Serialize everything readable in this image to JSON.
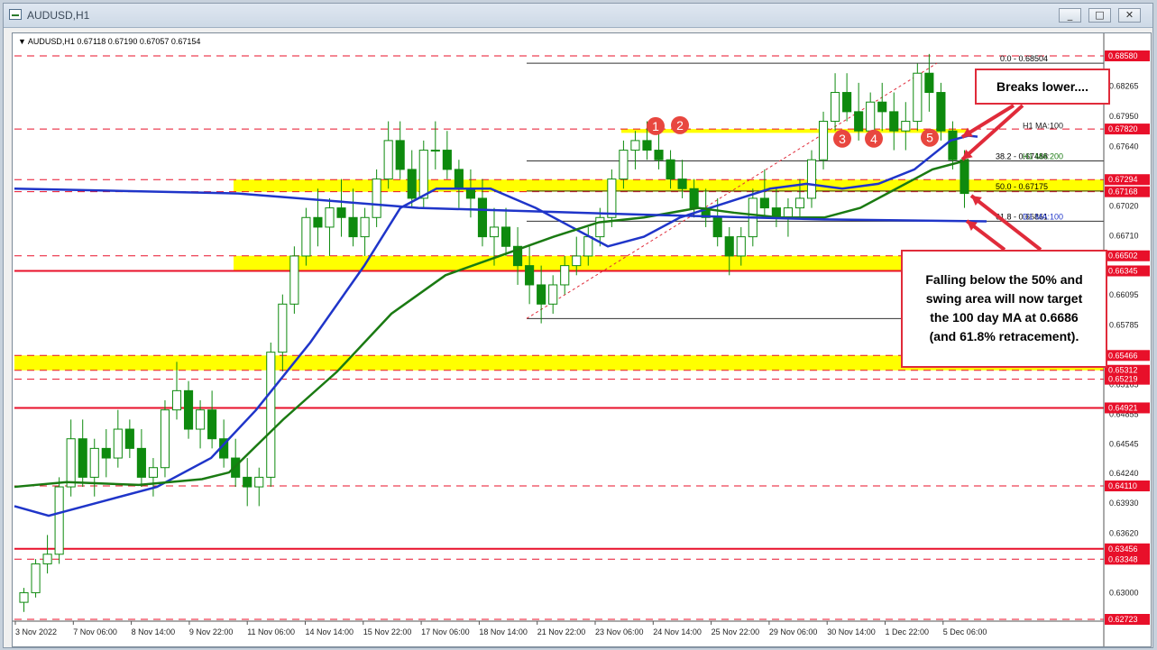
{
  "window": {
    "title": "AUDUSD,H1"
  },
  "window_buttons": {
    "minimize": "_",
    "maximize": "□",
    "close": "✕"
  },
  "chart_data": {
    "type": "candlestick",
    "symbol_info": "AUDUSD,H1  0.67118 0.67190 0.67057 0.67154",
    "ylim": [
      0.62723,
      0.6858
    ],
    "x_labels": [
      "3 Nov 2022",
      "7 Nov 06:00",
      "8 Nov 14:00",
      "9 Nov 22:00",
      "11 Nov 06:00",
      "14 Nov 14:00",
      "15 Nov 22:00",
      "17 Nov 06:00",
      "18 Nov 14:00",
      "21 Nov 22:00",
      "23 Nov 06:00",
      "24 Nov 14:00",
      "25 Nov 22:00",
      "29 Nov 06:00",
      "30 Nov 14:00",
      "1 Dec 22:00",
      "5 Dec 06:00"
    ],
    "y_ticks": [
      "0.68265",
      "0.67950",
      "0.67640",
      "0.67020",
      "0.66710",
      "0.66095",
      "0.65785",
      "0.65165",
      "0.64855",
      "0.64545",
      "0.64240",
      "0.63930",
      "0.63620",
      "0.63000"
    ],
    "price_labels": [
      {
        "text": "0.68580",
        "value": 0.6858,
        "color": "#e8102a"
      },
      {
        "text": "0.67820",
        "value": 0.6782,
        "color": "#e8102a"
      },
      {
        "text": "0.67294",
        "value": 0.67294,
        "color": "#e8102a"
      },
      {
        "text": "0.67168",
        "value": 0.67168,
        "color": "#e8102a"
      },
      {
        "text": "0.66502",
        "value": 0.66502,
        "color": "#e8102a"
      },
      {
        "text": "0.66345",
        "value": 0.66345,
        "color": "#e8102a"
      },
      {
        "text": "0.65466",
        "value": 0.65466,
        "color": "#e8102a"
      },
      {
        "text": "0.65312",
        "value": 0.65312,
        "color": "#e8102a"
      },
      {
        "text": "0.65219",
        "value": 0.65219,
        "color": "#e8102a"
      },
      {
        "text": "0.64921",
        "value": 0.64921,
        "color": "#e8102a"
      },
      {
        "text": "0.64110",
        "value": 0.6411,
        "color": "#e8102a"
      },
      {
        "text": "0.63456",
        "value": 0.63456,
        "color": "#e8102a"
      },
      {
        "text": "0.63348",
        "value": 0.63348,
        "color": "#e8102a"
      },
      {
        "text": "0.62723",
        "value": 0.62723,
        "color": "#e8102a"
      }
    ],
    "horizontal_levels": [
      {
        "value": 0.6858,
        "style": "dashed"
      },
      {
        "value": 0.6782,
        "style": "dashed"
      },
      {
        "value": 0.67294,
        "style": "dashed"
      },
      {
        "value": 0.67168,
        "style": "dashed"
      },
      {
        "value": 0.66502,
        "style": "dashed"
      },
      {
        "value": 0.66345,
        "style": "solid"
      },
      {
        "value": 0.65466,
        "style": "dashed"
      },
      {
        "value": 0.65312,
        "style": "dashed"
      },
      {
        "value": 0.65219,
        "style": "dashed"
      },
      {
        "value": 0.64921,
        "style": "solid"
      },
      {
        "value": 0.6411,
        "style": "dashed"
      },
      {
        "value": 0.63456,
        "style": "solid"
      },
      {
        "value": 0.63348,
        "style": "dashed"
      },
      {
        "value": 0.62723,
        "style": "dashed"
      }
    ],
    "swing_zones": [
      [
        0.67168,
        0.67294
      ],
      [
        0.66345,
        0.66502
      ],
      [
        0.65312,
        0.65466
      ],
      [
        0.6778,
        0.6782
      ]
    ],
    "fibonacci": [
      {
        "label": "0.0 - 0.68504",
        "value": 0.68504
      },
      {
        "label": "38.2 - 0.67488",
        "value": 0.67488
      },
      {
        "label": "50.0 - 0.67175",
        "value": 0.67175
      },
      {
        "label": "61.8 - 0.66861",
        "value": 0.66861
      }
    ],
    "fib_low": 0.6585,
    "ma_labels": [
      {
        "text": "H1 MA:100",
        "value": 0.67749
      },
      {
        "text": "H1 MA:200",
        "value": 0.67488
      },
      {
        "text": "D1 MA:100",
        "value": 0.66861
      }
    ],
    "candles": [
      [
        0.629,
        0.6305,
        0.628,
        0.63
      ],
      [
        0.63,
        0.6335,
        0.6295,
        0.633
      ],
      [
        0.633,
        0.636,
        0.632,
        0.634
      ],
      [
        0.634,
        0.642,
        0.633,
        0.641
      ],
      [
        0.641,
        0.648,
        0.64,
        0.646
      ],
      [
        0.646,
        0.648,
        0.641,
        0.642
      ],
      [
        0.642,
        0.646,
        0.64,
        0.645
      ],
      [
        0.645,
        0.647,
        0.642,
        0.644
      ],
      [
        0.644,
        0.649,
        0.643,
        0.647
      ],
      [
        0.647,
        0.648,
        0.644,
        0.645
      ],
      [
        0.645,
        0.647,
        0.641,
        0.642
      ],
      [
        0.642,
        0.644,
        0.64,
        0.643
      ],
      [
        0.643,
        0.65,
        0.642,
        0.649
      ],
      [
        0.649,
        0.654,
        0.648,
        0.651
      ],
      [
        0.651,
        0.652,
        0.646,
        0.647
      ],
      [
        0.647,
        0.65,
        0.645,
        0.649
      ],
      [
        0.649,
        0.651,
        0.645,
        0.646
      ],
      [
        0.646,
        0.648,
        0.643,
        0.644
      ],
      [
        0.644,
        0.646,
        0.641,
        0.642
      ],
      [
        0.642,
        0.644,
        0.639,
        0.641
      ],
      [
        0.641,
        0.643,
        0.639,
        0.642
      ],
      [
        0.642,
        0.656,
        0.641,
        0.655
      ],
      [
        0.655,
        0.661,
        0.653,
        0.66
      ],
      [
        0.66,
        0.666,
        0.659,
        0.665
      ],
      [
        0.665,
        0.67,
        0.664,
        0.669
      ],
      [
        0.669,
        0.672,
        0.666,
        0.668
      ],
      [
        0.668,
        0.671,
        0.665,
        0.67
      ],
      [
        0.67,
        0.673,
        0.667,
        0.669
      ],
      [
        0.669,
        0.672,
        0.666,
        0.667
      ],
      [
        0.667,
        0.67,
        0.665,
        0.669
      ],
      [
        0.669,
        0.674,
        0.668,
        0.673
      ],
      [
        0.673,
        0.679,
        0.672,
        0.677
      ],
      [
        0.677,
        0.679,
        0.673,
        0.674
      ],
      [
        0.674,
        0.676,
        0.67,
        0.671
      ],
      [
        0.671,
        0.677,
        0.67,
        0.676
      ],
      [
        0.676,
        0.679,
        0.674,
        0.676
      ],
      [
        0.676,
        0.678,
        0.673,
        0.674
      ],
      [
        0.674,
        0.675,
        0.67,
        0.672
      ],
      [
        0.672,
        0.674,
        0.669,
        0.671
      ],
      [
        0.671,
        0.673,
        0.666,
        0.667
      ],
      [
        0.667,
        0.67,
        0.664,
        0.668
      ],
      [
        0.668,
        0.67,
        0.665,
        0.666
      ],
      [
        0.666,
        0.668,
        0.662,
        0.664
      ],
      [
        0.664,
        0.666,
        0.66,
        0.662
      ],
      [
        0.662,
        0.664,
        0.658,
        0.66
      ],
      [
        0.66,
        0.663,
        0.659,
        0.662
      ],
      [
        0.662,
        0.665,
        0.661,
        0.664
      ],
      [
        0.664,
        0.667,
        0.663,
        0.665
      ],
      [
        0.665,
        0.668,
        0.664,
        0.667
      ],
      [
        0.667,
        0.67,
        0.666,
        0.669
      ],
      [
        0.669,
        0.674,
        0.668,
        0.673
      ],
      [
        0.673,
        0.677,
        0.672,
        0.676
      ],
      [
        0.676,
        0.678,
        0.674,
        0.677
      ],
      [
        0.677,
        0.679,
        0.675,
        0.676
      ],
      [
        0.676,
        0.679,
        0.674,
        0.675
      ],
      [
        0.675,
        0.676,
        0.672,
        0.673
      ],
      [
        0.673,
        0.675,
        0.671,
        0.672
      ],
      [
        0.672,
        0.673,
        0.669,
        0.67
      ],
      [
        0.67,
        0.672,
        0.668,
        0.669
      ],
      [
        0.669,
        0.671,
        0.666,
        0.667
      ],
      [
        0.667,
        0.668,
        0.663,
        0.665
      ],
      [
        0.665,
        0.668,
        0.664,
        0.667
      ],
      [
        0.667,
        0.672,
        0.666,
        0.671
      ],
      [
        0.671,
        0.674,
        0.669,
        0.67
      ],
      [
        0.67,
        0.672,
        0.668,
        0.669
      ],
      [
        0.669,
        0.671,
        0.667,
        0.67
      ],
      [
        0.67,
        0.673,
        0.669,
        0.671
      ],
      [
        0.671,
        0.676,
        0.67,
        0.675
      ],
      [
        0.675,
        0.68,
        0.674,
        0.679
      ],
      [
        0.679,
        0.684,
        0.678,
        0.682
      ],
      [
        0.682,
        0.684,
        0.679,
        0.68
      ],
      [
        0.68,
        0.683,
        0.677,
        0.678
      ],
      [
        0.678,
        0.682,
        0.677,
        0.681
      ],
      [
        0.681,
        0.683,
        0.678,
        0.68
      ],
      [
        0.68,
        0.682,
        0.676,
        0.678
      ],
      [
        0.678,
        0.681,
        0.676,
        0.679
      ],
      [
        0.679,
        0.685,
        0.678,
        0.684
      ],
      [
        0.684,
        0.686,
        0.68,
        0.682
      ],
      [
        0.682,
        0.683,
        0.677,
        0.678
      ],
      [
        0.678,
        0.679,
        0.674,
        0.675
      ],
      [
        0.675,
        0.676,
        0.67,
        0.6715
      ]
    ]
  },
  "annotations": {
    "markers": [
      "1",
      "2",
      "3",
      "4",
      "5"
    ],
    "callout_top": "Breaks lower....",
    "callout_main": [
      "Falling below the 50% and",
      "swing area will now target",
      "the 100 day MA at 0.6686",
      "(and 61.8% retracement)."
    ]
  },
  "colors": {
    "zone": "#ffff00",
    "level": "#e8102a",
    "ma_fast": "#1f35c9",
    "ma_slow": "#1a7a12",
    "ma_daily": "#1f35c9",
    "candle": "#0e8a0e",
    "arrow": "#e02b3a"
  }
}
